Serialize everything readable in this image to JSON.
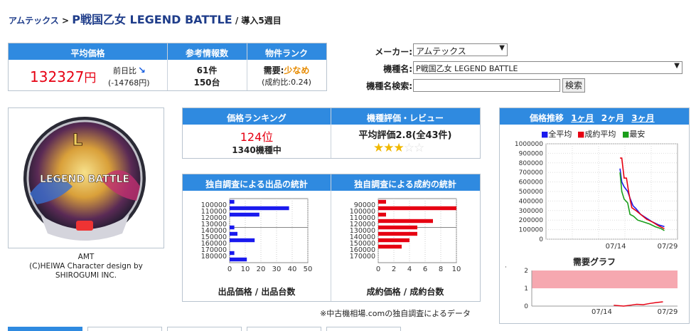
{
  "breadcrumb": {
    "maker": "アムテックス",
    "sep": ">",
    "model": "P戦国乙女 LEGEND BATTLE",
    "intro": "/ 導入5週目"
  },
  "summary": {
    "headers": [
      "平均価格",
      "参考情報数",
      "物件ランク"
    ],
    "avg_price": "132327",
    "yen": "円",
    "prev_label": "前日比",
    "prev_diff": "(-14768円)",
    "info_count1": "61件",
    "info_count2": "150台",
    "demand_label": "需要:",
    "demand_value": "少なめ",
    "ratio": "(成約比:0.24)"
  },
  "search": {
    "maker_label": "メーカー:",
    "maker_value": "アムテックス",
    "model_label": "機種名:",
    "model_value": "P戦国乙女 LEGEND BATTLE",
    "query_label": "機種名検索:",
    "query_value": "",
    "search_button": "検索"
  },
  "image_caption": [
    "AMT",
    "(C)HEIWA Character design by",
    "SHIROGUMI INC."
  ],
  "logo_text": "LEGEND BATTLE",
  "ranking": {
    "header": "価格ランキング",
    "rank": "124位",
    "of": "1340機種中"
  },
  "review": {
    "header": "機種評価・レビュー",
    "text": "平均評価2.8(全43件)",
    "stars": 2.8
  },
  "trend": {
    "header": "価格推移",
    "tabs": [
      "1ヶ月",
      "2ヶ月",
      "3ヶ月"
    ]
  },
  "listing_stats": {
    "header": "独自調査による出品の統計",
    "xlabel": "出品価格 / 出品台数"
  },
  "contract_stats": {
    "header": "独自調査による成約の統計",
    "xlabel": "成約価格 / 成約台数"
  },
  "footnote": "※中古機相場.comの独自調査によるデータ",
  "demand_graph": {
    "title": "需要グラフ"
  },
  "colors": {
    "header_blue": "#2f8ae0",
    "price_red": "#e60012",
    "listing_blue": "#1a1aee",
    "contract_red": "#e60012",
    "demand_orange": "#e68a00",
    "min_green": "#1a9e1a"
  },
  "chart_data": [
    {
      "type": "bar",
      "title": "",
      "orientation": "horizontal",
      "categories": [
        "100000",
        "110000",
        "120000",
        "130000",
        "140000",
        "150000",
        "160000",
        "170000",
        "180000"
      ],
      "values": [
        3,
        38,
        19,
        0,
        3,
        5,
        16,
        0,
        3,
        11
      ],
      "xlim": [
        0,
        50
      ],
      "xticks": [
        "0",
        "10",
        "20",
        "30",
        "40",
        "50"
      ],
      "xlabel": "出品価格 / 出品台数",
      "color": "#1a1aee"
    },
    {
      "type": "bar",
      "title": "",
      "orientation": "horizontal",
      "categories": [
        "90000",
        "100000",
        "110000",
        "120000",
        "130000",
        "140000",
        "150000",
        "160000",
        "170000"
      ],
      "values": [
        1,
        10,
        1,
        7,
        5,
        5,
        4,
        3
      ],
      "xlim": [
        0,
        10
      ],
      "xticks": [
        "0",
        "2",
        "4",
        "6",
        "8",
        "10"
      ],
      "xlabel": "成約価格 / 成約台数",
      "color": "#e60012"
    },
    {
      "type": "line",
      "title": "",
      "legend": [
        "全平均",
        "成約平均",
        "最安"
      ],
      "legend_colors": [
        "#1a1aee",
        "#e60012",
        "#1a9e1a"
      ],
      "yticks": [
        "1000000",
        "900000",
        "800000",
        "700000",
        "600000",
        "500000",
        "400000",
        "300000",
        "200000",
        "100000",
        "0"
      ],
      "ylim": [
        0,
        1000000
      ],
      "xticks": [
        "07/14",
        "07/29"
      ],
      "series": [
        {
          "name": "全平均",
          "x": [
            0.25,
            0.28,
            0.32,
            0.38,
            0.42,
            0.47,
            0.52,
            0.6,
            0.7,
            0.8,
            0.9,
            1.0
          ],
          "values": [
            740000,
            600000,
            550000,
            500000,
            430000,
            350000,
            320000,
            260000,
            220000,
            180000,
            150000,
            132327
          ]
        },
        {
          "name": "成約平均",
          "x": [
            0.25,
            0.28,
            0.32,
            0.36,
            0.4,
            0.45,
            0.52,
            0.6,
            0.7,
            0.8,
            0.9,
            1.0
          ],
          "values": [
            850000,
            850000,
            640000,
            640000,
            480000,
            330000,
            300000,
            260000,
            210000,
            180000,
            140000,
            110000
          ]
        },
        {
          "name": "最安",
          "x": [
            0.25,
            0.28,
            0.32,
            0.38,
            0.42,
            0.48,
            0.55,
            0.65,
            0.75,
            0.85,
            0.95,
            1.0
          ],
          "values": [
            700000,
            500000,
            420000,
            380000,
            260000,
            240000,
            200000,
            180000,
            160000,
            130000,
            110000,
            90000
          ]
        }
      ]
    },
    {
      "type": "area",
      "title": "需要グラフ",
      "yticks": [
        "2",
        "1",
        "0"
      ],
      "ylim": [
        0,
        2
      ],
      "xticks": [
        "07/14",
        "07/29"
      ],
      "high_band": [
        1,
        2
      ],
      "series": [
        {
          "name": "需要",
          "x": [
            0.25,
            0.4,
            0.5,
            0.6,
            0.7,
            0.8,
            0.9,
            1.0
          ],
          "values": [
            0.05,
            0.0,
            0.05,
            0.1,
            0.08,
            0.15,
            0.2,
            0.24
          ]
        }
      ]
    }
  ]
}
